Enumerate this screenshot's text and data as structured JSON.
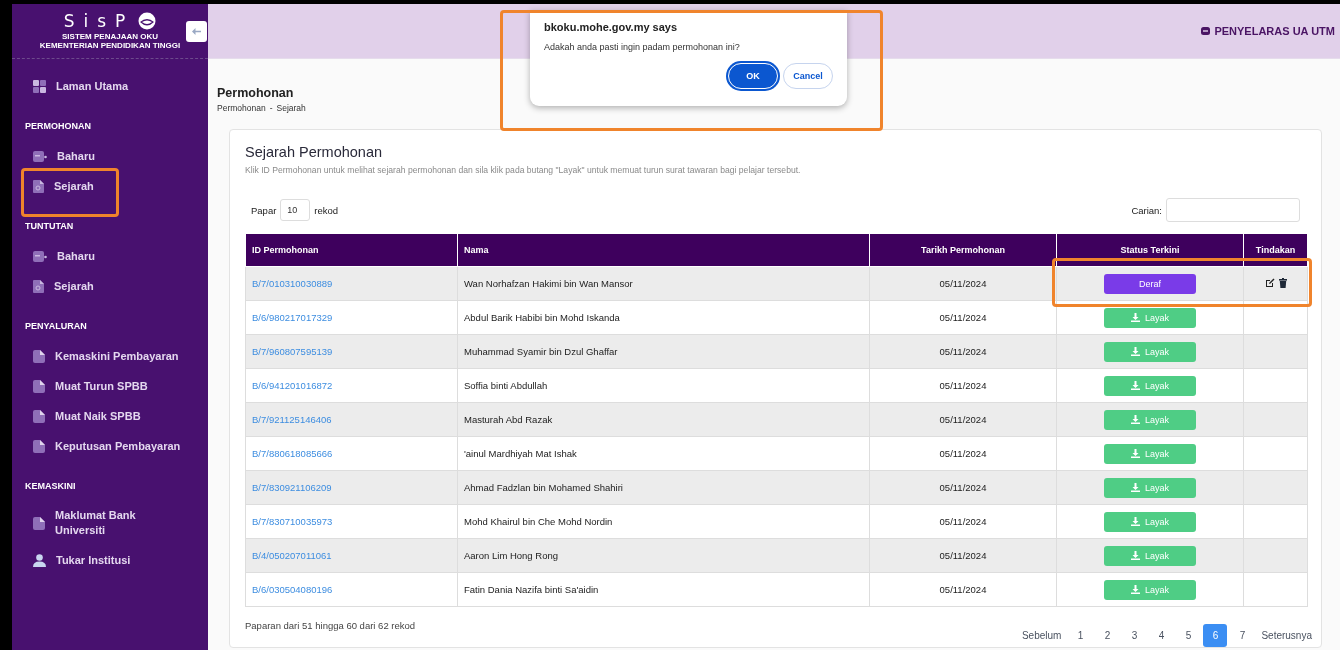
{
  "sidebar": {
    "logo": {
      "title": "SisP",
      "subtitle_lines": [
        "SISTEM PENAJAAN OKU",
        "KEMENTERIAN PENDIDIKAN TINGGI"
      ]
    },
    "top_items": [
      {
        "label": "Laman Utama",
        "kind": "home",
        "highlighted": false
      }
    ],
    "sections": [
      {
        "heading": "PERMOHONAN",
        "items": [
          {
            "label": "Baharu",
            "kind": "new",
            "highlighted": false
          },
          {
            "label": "Sejarah",
            "kind": "history",
            "highlighted": true
          }
        ]
      },
      {
        "heading": "TUNTUTAN",
        "items": [
          {
            "label": "Baharu",
            "kind": "new",
            "highlighted": false
          },
          {
            "label": "Sejarah",
            "kind": "history",
            "highlighted": false
          }
        ]
      },
      {
        "heading": "PENYALURAN",
        "items": [
          {
            "label": "Kemaskini Pembayaran",
            "kind": "page",
            "highlighted": false
          },
          {
            "label": "Muat Turun SPBB",
            "kind": "page",
            "highlighted": false
          },
          {
            "label": "Muat Naik SPBB",
            "kind": "page",
            "highlighted": false
          },
          {
            "label": "Keputusan Pembayaran",
            "kind": "page",
            "highlighted": false
          }
        ]
      },
      {
        "heading": "KEMASKINI",
        "items": [
          {
            "label": "Maklumat Bank Universiti",
            "kind": "page",
            "highlighted": false
          },
          {
            "label": "Tukar Institusi",
            "kind": "user",
            "highlighted": false
          }
        ]
      }
    ]
  },
  "top_bar": {
    "user": "PENYELARAS UA UTM"
  },
  "page": {
    "title": "Permohonan",
    "breadcrumb": [
      "Permohonan",
      "-",
      "Sejarah"
    ]
  },
  "card": {
    "title": "Sejarah Permohonan",
    "description": "Klik ID Permohonan untuk melihat sejarah permohonan dan sila klik pada butang \"Layak\" untuk memuat turun surat tawaran bagi pelajar tersebut.",
    "show_label": "Papar",
    "show_value": "10",
    "show_suffix": "rekod",
    "search_label": "Carian:",
    "table": {
      "columns": [
        "ID Permohonan",
        "Nama",
        "Tarikh Permohonan",
        "Status Terkini",
        "Tindakan"
      ],
      "rows": [
        {
          "id": "B/7/010310030889",
          "name": "Wan Norhafzan Hakimi bin Wan Mansor",
          "date": "05/11/2024",
          "status": "Deraf",
          "kind": "draft",
          "highlighted": true
        },
        {
          "id": "B/6/980217017329",
          "name": "Abdul Barik Habibi bin Mohd Iskanda",
          "date": "05/11/2024",
          "status": "Layak",
          "kind": "eligible",
          "highlighted": false
        },
        {
          "id": "B/7/960807595139",
          "name": "Muhammad Syamir bin Dzul Ghaffar",
          "date": "05/11/2024",
          "status": "Layak",
          "kind": "eligible",
          "highlighted": false
        },
        {
          "id": "B/6/941201016872",
          "name": "Soffia binti Abdullah",
          "date": "05/11/2024",
          "status": "Layak",
          "kind": "eligible",
          "highlighted": false
        },
        {
          "id": "B/7/921125146406",
          "name": "Masturah Abd Razak",
          "date": "05/11/2024",
          "status": "Layak",
          "kind": "eligible",
          "highlighted": false
        },
        {
          "id": "B/7/880618085666",
          "name": "'ainul Mardhiyah Mat Ishak",
          "date": "05/11/2024",
          "status": "Layak",
          "kind": "eligible",
          "highlighted": false
        },
        {
          "id": "B/7/830921106209",
          "name": "Ahmad Fadzlan bin Mohamed Shahiri",
          "date": "05/11/2024",
          "status": "Layak",
          "kind": "eligible",
          "highlighted": false
        },
        {
          "id": "B/7/830710035973",
          "name": "Mohd Khairul bin Che Mohd Nordin",
          "date": "05/11/2024",
          "status": "Layak",
          "kind": "eligible",
          "highlighted": false
        },
        {
          "id": "B/4/050207011061",
          "name": "Aaron Lim Hong Rong",
          "date": "05/11/2024",
          "status": "Layak",
          "kind": "eligible",
          "highlighted": false
        },
        {
          "id": "B/6/030504080196",
          "name": "Fatin Dania Nazifa binti Sa'aidin",
          "date": "05/11/2024",
          "status": "Layak",
          "kind": "eligible",
          "highlighted": false
        }
      ]
    },
    "summary": "Paparan dari 51 hingga 60 dari 62 rekod",
    "pagination": [
      {
        "label": "Sebelum",
        "selected": false
      },
      {
        "label": "1",
        "selected": false
      },
      {
        "label": "2",
        "selected": false
      },
      {
        "label": "3",
        "selected": false
      },
      {
        "label": "4",
        "selected": false
      },
      {
        "label": "5",
        "selected": false
      },
      {
        "label": "6",
        "selected": true
      },
      {
        "label": "7",
        "selected": false
      },
      {
        "label": "Seterusnya",
        "selected": false
      }
    ]
  },
  "dialog": {
    "title": "bkoku.mohe.gov.my says",
    "message": "Adakah anda pasti ingin padam permohonan ini?",
    "buttons": [
      {
        "label": "OK",
        "kind": "primary"
      },
      {
        "label": "Cancel",
        "kind": "secondary"
      }
    ],
    "highlighted": true
  }
}
